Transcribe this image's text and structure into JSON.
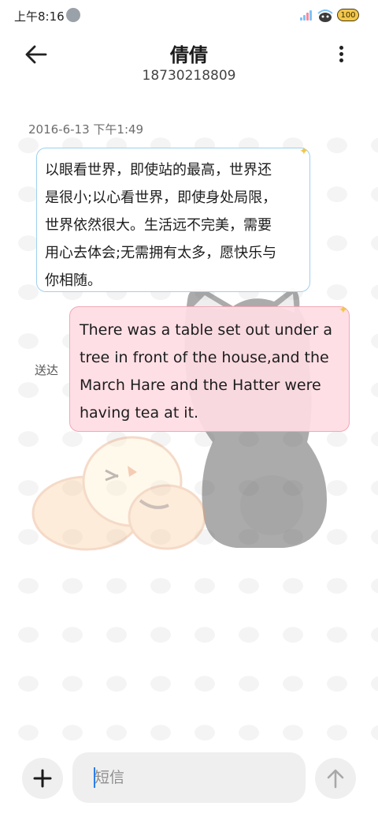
{
  "status_bar": {
    "time": "上午8:16",
    "battery": "100",
    "signal_color": "#7ec3f5",
    "battery_color": "#f2c84b"
  },
  "header": {
    "title": "倩倩",
    "subtitle": "18730218809",
    "back_icon": "arrow-left-icon",
    "more_icon": "more-vertical-icon"
  },
  "conversation": {
    "timestamp": "2016-6-13 下午1:49",
    "messages": [
      {
        "direction": "incoming",
        "lines": [
          "以眼看世界，即使站的最高，世界还",
          "是很小;以心看世界，即使身处局限，",
          "世界依然很大。生活远不完美，需要",
          "用心去体会;无需拥有太多，愿快乐与",
          "你相随。"
        ],
        "border_color": "#9dd0f0"
      },
      {
        "direction": "outgoing",
        "lines": [
          "There was a table set out under a",
          "tree in front of the house,and the",
          "March Hare and the Hatter were",
          "having tea at it."
        ],
        "status": "送达",
        "background_color": "#ffdde4"
      }
    ]
  },
  "compose": {
    "placeholder": "短信",
    "add_icon": "plus-icon",
    "send_icon": "arrow-up-icon"
  }
}
